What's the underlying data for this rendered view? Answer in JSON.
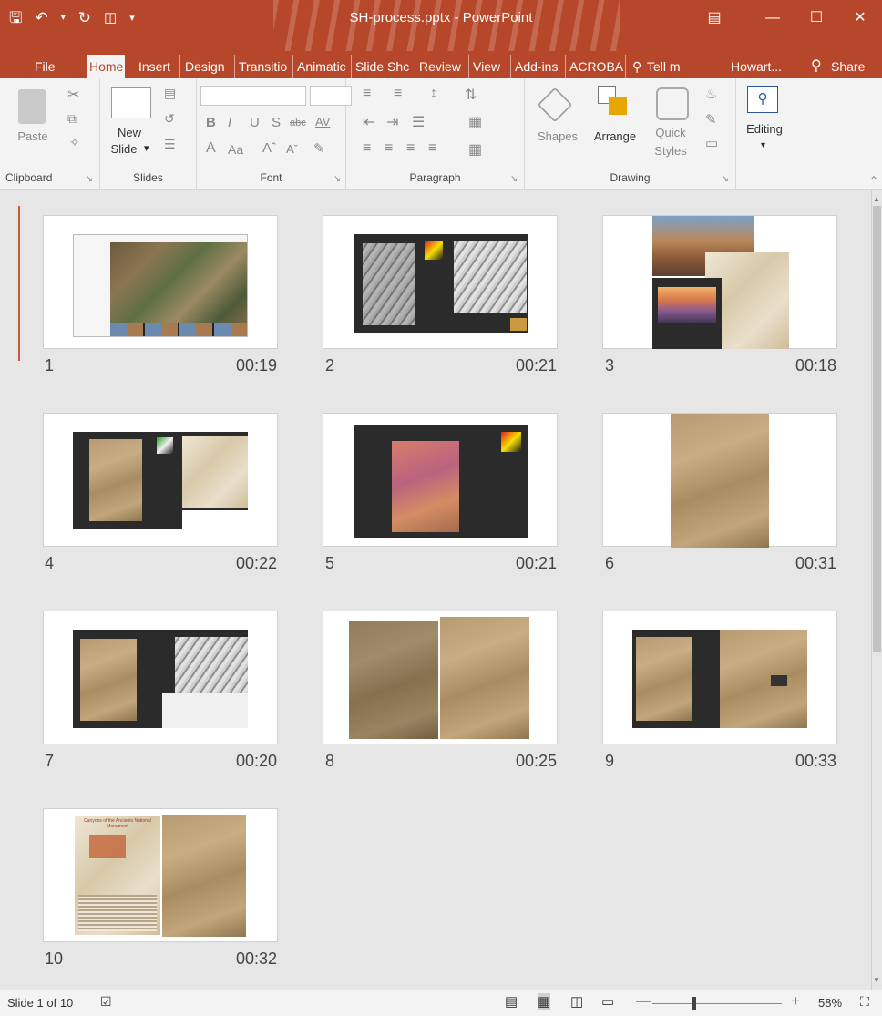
{
  "window": {
    "title": "SH-process.pptx - PowerPoint",
    "accent": "#b7472a"
  },
  "qat": {
    "save_icon": "save-icon",
    "undo_icon": "undo-icon",
    "redo_icon": "redo-icon",
    "start_icon": "start-from-beginning-icon",
    "customize_icon": "customize-dropdown-icon"
  },
  "tabs": [
    {
      "label": "File"
    },
    {
      "label": "Home"
    },
    {
      "label": "Insert"
    },
    {
      "label": "Design"
    },
    {
      "label": "Transitio"
    },
    {
      "label": "Animatic"
    },
    {
      "label": "Slide Shc"
    },
    {
      "label": "Review"
    },
    {
      "label": "View"
    },
    {
      "label": "Add-ins"
    },
    {
      "label": "ACROBA"
    },
    {
      "label": "Tell m"
    },
    {
      "label": "Howart..."
    },
    {
      "label": "Share"
    }
  ],
  "ribbon": {
    "paste_label": "Paste",
    "new_slide_label_1": "New",
    "new_slide_label_2": "Slide",
    "shapes_label": "Shapes",
    "arrange_label": "Arrange",
    "quick_styles_label_1": "Quick",
    "quick_styles_label_2": "Styles",
    "editing_label": "Editing",
    "groups": {
      "clipboard": "Clipboard",
      "slides": "Slides",
      "font": "Font",
      "paragraph": "Paragraph",
      "drawing": "Drawing"
    },
    "font_buttons": {
      "bold": "B",
      "italic": "I",
      "underline": "U",
      "shadow": "S",
      "strike": "abc",
      "spacing": "AV",
      "font_color": "A",
      "case": "Aa",
      "grow": "Aˆ",
      "shrink": "Aˇ"
    }
  },
  "slides": [
    {
      "number": "1",
      "time": "00:19"
    },
    {
      "number": "2",
      "time": "00:21"
    },
    {
      "number": "3",
      "time": "00:18"
    },
    {
      "number": "4",
      "time": "00:22"
    },
    {
      "number": "5",
      "time": "00:21"
    },
    {
      "number": "6",
      "time": "00:31"
    },
    {
      "number": "7",
      "time": "00:20"
    },
    {
      "number": "8",
      "time": "00:25"
    },
    {
      "number": "9",
      "time": "00:33"
    },
    {
      "number": "10",
      "time": "00:32"
    }
  ],
  "slide10_poster_title": "Canyons of the Ancients National Monument",
  "status": {
    "slide_info": "Slide 1 of 10",
    "zoom": "58%"
  }
}
